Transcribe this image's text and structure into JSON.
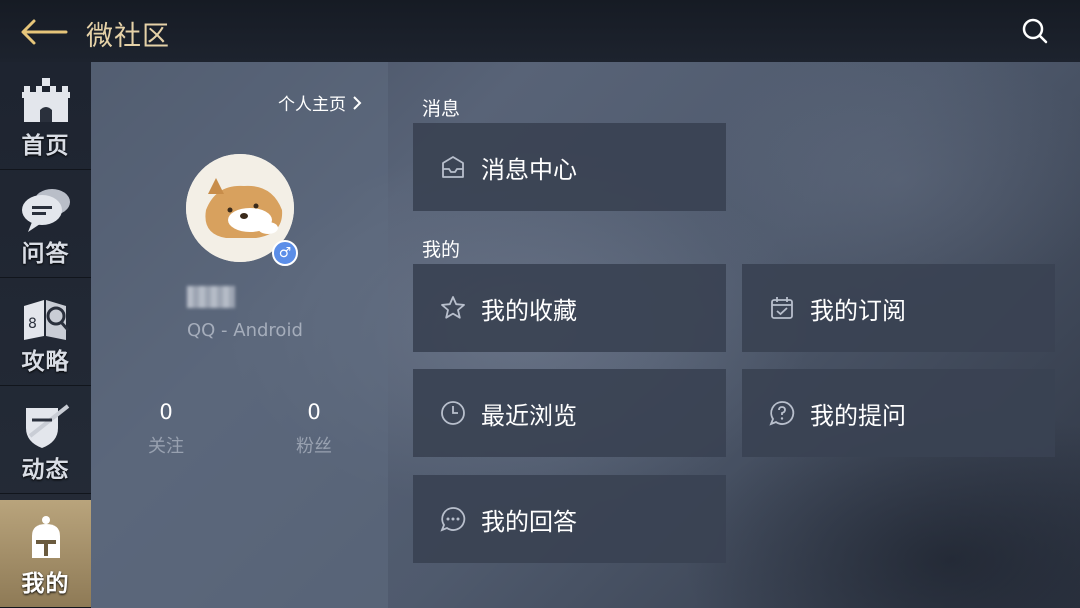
{
  "header": {
    "title": "微社区",
    "back_icon": "back-arrow-icon",
    "search_icon": "search-icon"
  },
  "sidenav": {
    "items": [
      {
        "label": "首页",
        "icon": "castle-icon",
        "active": false
      },
      {
        "label": "问答",
        "icon": "speech-bubble-icon",
        "active": false
      },
      {
        "label": "攻略",
        "icon": "guide-book-icon",
        "active": false
      },
      {
        "label": "动态",
        "icon": "shield-sword-icon",
        "active": false
      },
      {
        "label": "我的",
        "icon": "knight-helmet-icon",
        "active": true
      }
    ]
  },
  "profile": {
    "home_link": "个人主页",
    "platform": "QQ - Android",
    "gender_symbol": "♂",
    "following_count": "0",
    "following_label": "关注",
    "followers_count": "0",
    "followers_label": "粉丝"
  },
  "messages": {
    "section_title": "消息",
    "items": [
      {
        "label": "消息中心",
        "icon": "mail-icon"
      }
    ]
  },
  "mine": {
    "section_title": "我的",
    "items": [
      {
        "label": "我的收藏",
        "icon": "star-icon"
      },
      {
        "label": "我的订阅",
        "icon": "calendar-check-icon"
      },
      {
        "label": "最近浏览",
        "icon": "clock-icon"
      },
      {
        "label": "我的提问",
        "icon": "question-bubble-icon"
      },
      {
        "label": "我的回答",
        "icon": "ellipsis-bubble-icon"
      }
    ]
  },
  "colors": {
    "title_gold": "#e6d2a8",
    "active_tab": "#b9a47c",
    "card_bg": "#3a4252",
    "gender_blue": "#5b8ee8"
  }
}
